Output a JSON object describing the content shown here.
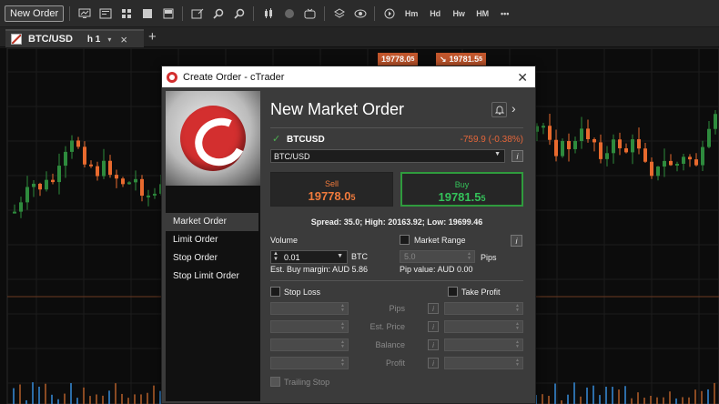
{
  "toolbar": {
    "new_order_label": "New Order",
    "icons": [
      "monitor-chart-icon",
      "chart-layout-icon",
      "grid-4-icon",
      "single-window-icon",
      "split-window-icon",
      "edit-chart-icon",
      "zoom-in-icon",
      "zoom-out-icon",
      "candles-icon",
      "circle-icon",
      "tv-icon",
      "layers-icon",
      "eye-icon",
      "replay-icon"
    ],
    "hm_labels": [
      "Hm",
      "Hd",
      "Hw",
      "HM"
    ],
    "more_label": "•••"
  },
  "tab": {
    "symbol": "BTC/USD",
    "timeframe": "h 1",
    "dropdown": "▾",
    "close": "×",
    "add": "+"
  },
  "chart": {
    "sell_label": "19778.0",
    "sell_sup": "5",
    "buy_label": "19781.5",
    "buy_sup": "5",
    "up_color": "#2e8b3d",
    "down_color": "#e86a2e"
  },
  "dialog": {
    "title": "Create Order - cTrader",
    "close": "✕",
    "sidebar": {
      "items": [
        {
          "label": "Market Order",
          "active": true
        },
        {
          "label": "Limit Order",
          "active": false
        },
        {
          "label": "Stop Order",
          "active": false
        },
        {
          "label": "Stop Limit Order",
          "active": false
        }
      ]
    },
    "heading": "New Market Order",
    "symbol": "BTCUSD",
    "change": "-759.9 (-0.38%)",
    "symbol_select": "BTC/USD",
    "info": "i",
    "sell": {
      "label": "Sell",
      "price": "19778.0",
      "pip": "5"
    },
    "buy": {
      "label": "Buy",
      "price": "19781.5",
      "pip": "5"
    },
    "spread_text": "Spread: 35.0; High: 20163.92; Low: 19699.46",
    "volume_label": "Volume",
    "volume_value": "0.01",
    "volume_unit": "BTC",
    "margin_text": "Est. Buy margin: AUD 5.86",
    "market_range_label": "Market Range",
    "market_range_value": "5.0",
    "pips_label": "Pips",
    "pip_value_text": "Pip value: AUD 0.00",
    "stop_loss_label": "Stop Loss",
    "take_profit_label": "Take Profit",
    "sl_tp_rows": [
      "Pips",
      "Est. Price",
      "Balance",
      "Profit"
    ],
    "trailing_stop_label": "Trailing Stop"
  }
}
